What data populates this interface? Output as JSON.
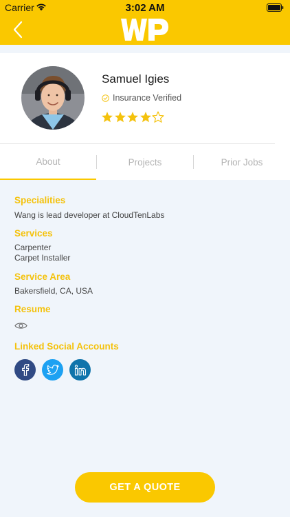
{
  "status_bar": {
    "carrier": "Carrier",
    "time": "3:02 AM",
    "wifi_icon": "wifi-icon",
    "battery_icon": "battery-icon"
  },
  "nav": {
    "back_icon": "chevron-left-icon",
    "logo_text": "WP"
  },
  "profile": {
    "name": "Samuel Igies",
    "verified_label": "Insurance Verified",
    "rating": {
      "value": 4,
      "max": 5
    }
  },
  "tabs": [
    {
      "label": "About"
    },
    {
      "label": "Projects"
    },
    {
      "label": "Prior Jobs"
    }
  ],
  "about": {
    "specialities_heading": "Specialities",
    "specialities_text": "Wang is lead developer at CloudTenLabs",
    "services_heading": "Services",
    "services": [
      "Carpenter",
      "Carpet Installer"
    ],
    "service_area_heading": "Service Area",
    "service_area_text": "Bakersfield, CA, USA",
    "resume_heading": "Resume",
    "social_heading": "Linked Social Accounts",
    "social": [
      {
        "name": "facebook",
        "glyph": "f"
      },
      {
        "name": "twitter",
        "glyph": ""
      },
      {
        "name": "linkedin",
        "glyph": "in"
      }
    ]
  },
  "cta": {
    "label": "GET A QUOTE"
  },
  "colors": {
    "accent": "#fac800",
    "heading": "#f4c20d",
    "background": "#f0f5fb"
  }
}
